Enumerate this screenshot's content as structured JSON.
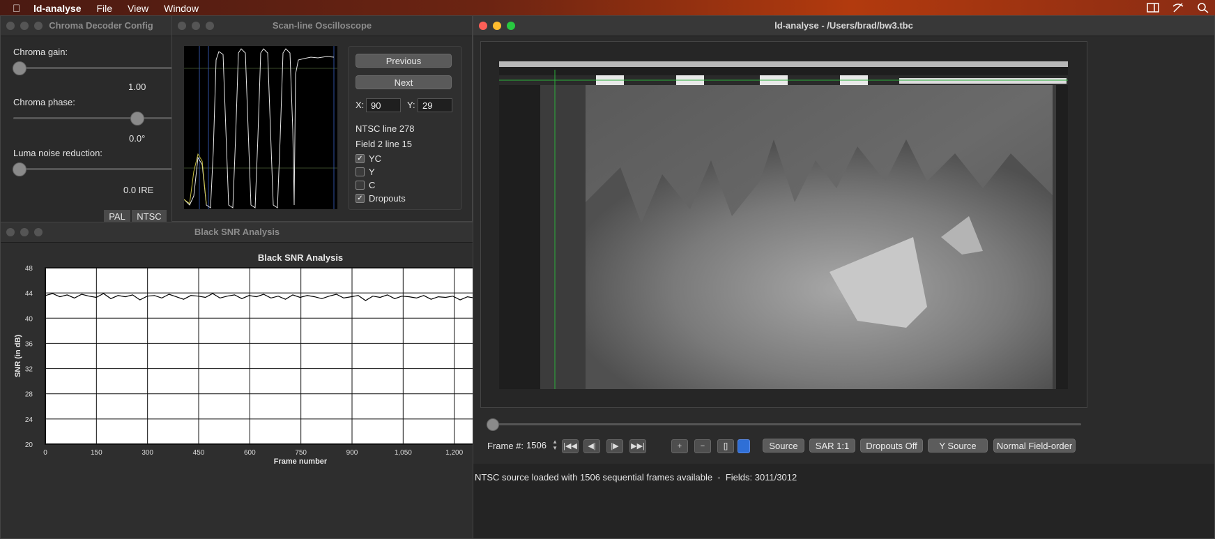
{
  "menubar": {
    "app_name": "ld-analyse",
    "items": [
      "File",
      "View",
      "Window"
    ]
  },
  "chroma": {
    "title": "Chroma Decoder Config",
    "gain_label": "Chroma gain:",
    "gain_value": "1.00",
    "phase_label": "Chroma phase:",
    "phase_value": "0.0°",
    "noise_label": "Luma noise reduction:",
    "noise_value": "0.0 IRE",
    "pal_label": "PAL",
    "ntsc_label": "NTSC"
  },
  "scope": {
    "title": "Scan-line Oscilloscope",
    "previous_label": "Previous",
    "next_label": "Next",
    "x_label": "X:",
    "x_value": "90",
    "y_label": "Y:",
    "y_value": "29",
    "ntsc_line": "NTSC line 278",
    "field_line": "Field 2 line 15",
    "checks": [
      {
        "label": "YC",
        "checked": true
      },
      {
        "label": "Y",
        "checked": false
      },
      {
        "label": "C",
        "checked": false
      },
      {
        "label": "Dropouts",
        "checked": true
      }
    ]
  },
  "main": {
    "title": "ld-analyse - /Users/brad/bw3.tbc",
    "frame_label": "Frame #:",
    "frame_value": "1506",
    "source_label": "Source",
    "sar_label": "SAR 1:1",
    "dropouts_label": "Dropouts Off",
    "ysource_label": "Y Source",
    "fieldorder_label": "Normal Field-order",
    "status": "NTSC source loaded with 1506 sequential frames available  -  Fields: 3011/3012"
  },
  "snr_window": {
    "title": "Black SNR Analysis"
  },
  "chart_data": {
    "type": "line",
    "title": "Black SNR Analysis",
    "xlabel": "Frame number",
    "ylabel": "SNR (in dB)",
    "xlim": [
      0,
      1260
    ],
    "ylim": [
      20,
      48
    ],
    "x_ticks": [
      "0",
      "150",
      "300",
      "450",
      "600",
      "750",
      "900",
      "1,050",
      "1,200"
    ],
    "y_ticks": [
      "48",
      "44",
      "40",
      "36",
      "32",
      "28",
      "24",
      "20"
    ],
    "grid": true,
    "series": [
      {
        "values": [
          43.6,
          43.9,
          43.4,
          43.7,
          43.2,
          43.8,
          43.5,
          43.3,
          43.9,
          43.1,
          43.6,
          43.4,
          43.7,
          42.9,
          43.5,
          43.6,
          43.2,
          43.8,
          43.4,
          43.0,
          43.6,
          43.5,
          43.3,
          43.9,
          43.2,
          43.5,
          43.7,
          43.1,
          43.6,
          43.4,
          43.8,
          43.2,
          43.5,
          43.0,
          43.7,
          43.3,
          43.6,
          43.4,
          43.1,
          43.5,
          43.8,
          43.2,
          43.4,
          43.6,
          42.8,
          43.5,
          43.3,
          43.7,
          43.1,
          43.5,
          43.4,
          43.2,
          43.6,
          43.0,
          43.4,
          43.3,
          43.5,
          42.9,
          43.4,
          43.2
        ]
      }
    ]
  }
}
